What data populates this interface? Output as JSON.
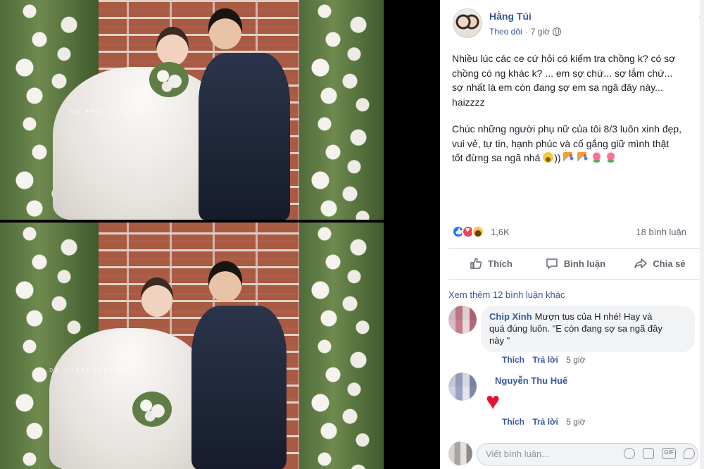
{
  "post": {
    "author": "Hằng Túi",
    "follow_label": "Theo dõi",
    "separator": "·",
    "time": "7 giờ",
    "text_lines_1": [
      "Nhiều lúc các ce cứ hỏi có kiểm tra chồng k? có sợ",
      "chồng có ng khác k? ... em sợ chứ... sợ lắm chứ...",
      "sợ nhất là em còn đang sợ em sa ngã đây này...",
      "haizzzz"
    ],
    "text_lines_2": [
      "Chúc những người phụ nữ của tôi 8/3 luôn xinh đẹp,",
      "vui vẻ, tự tin, hạnh phúc và cố gắng giữ mình thật",
      "tốt đừng sa ngã nhá"
    ],
    "text_tail": "))",
    "reaction_count": "1,6K",
    "comment_count": "18 bình luận"
  },
  "actions": {
    "like": "Thích",
    "comment": "Bình luận",
    "share": "Chia sẻ"
  },
  "comments": {
    "view_more": "Xem thêm 12 bình luận khác",
    "items": [
      {
        "name": "Chip Xinh",
        "text_lines": [
          "Mượn tus của H nhé! Hay và",
          "quá đúng luôn. \"E còn đang sợ sa ngã đây",
          "này \""
        ],
        "like": "Thích",
        "reply": "Trả lời",
        "time": "5 giờ"
      },
      {
        "name": "Nguyễn Thu Huế",
        "text": "",
        "like": "Thích",
        "reply": "Trả lời",
        "time": "5 giờ"
      }
    ],
    "write_placeholder": "Viết bình luận...",
    "gif_label": "GIF"
  },
  "photo": {
    "watermark": "DZ PHOTOGRAPHY"
  },
  "colors": {
    "link": "#385898",
    "text": "#1d2129",
    "muted": "#606770"
  }
}
